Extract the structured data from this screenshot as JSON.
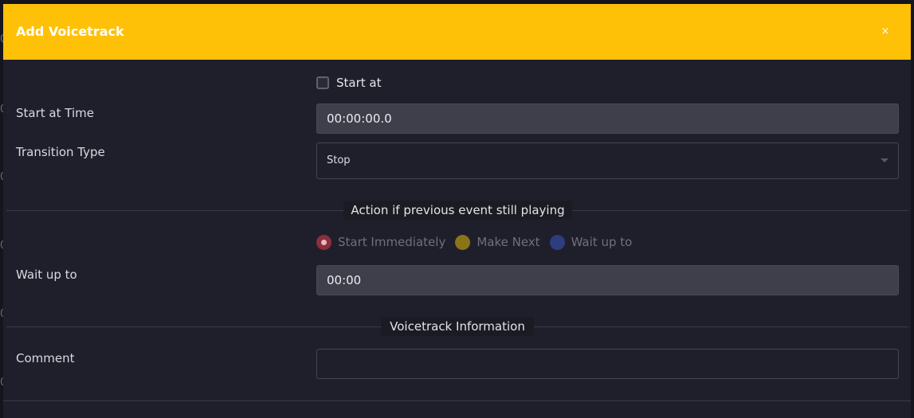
{
  "modal": {
    "title": "Add Voicetrack",
    "close_label": "×"
  },
  "start_at": {
    "checkbox_label": "Start at",
    "checked": false
  },
  "start_at_time": {
    "label": "Start at Time",
    "value": "00:00:00.0"
  },
  "transition_type": {
    "label": "Transition Type",
    "selected": "Stop"
  },
  "action_section": {
    "legend": "Action if previous event still playing",
    "options": [
      {
        "label": "Start Immediately",
        "selected": true,
        "color": "#8a2f3d"
      },
      {
        "label": "Make Next",
        "selected": false,
        "color": "#8a7418"
      },
      {
        "label": "Wait up to",
        "selected": false,
        "color": "#2f3d80"
      }
    ]
  },
  "wait_up_to": {
    "label": "Wait up to",
    "value": "00:00"
  },
  "voicetrack_section": {
    "legend": "Voicetrack Information"
  },
  "comment": {
    "label": "Comment",
    "value": ""
  },
  "colors": {
    "header": "#ffc107",
    "modal_bg": "#1f1f2b",
    "input_bg": "#3f3f4b"
  }
}
